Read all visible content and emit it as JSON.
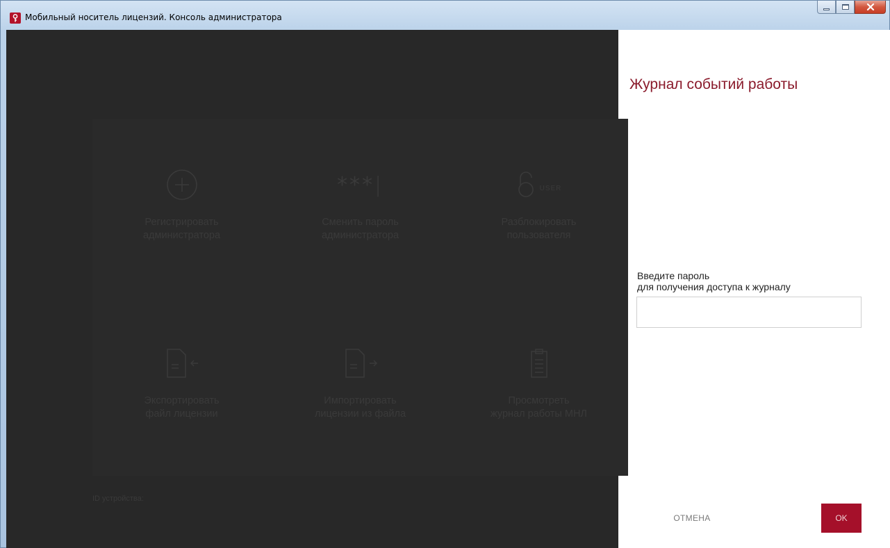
{
  "window": {
    "title": "Мобильный носитель лицензий. Консоль администратора"
  },
  "tiles": [
    {
      "icon": "plus-circle-icon",
      "label": "Регистрировать\nадминистратора"
    },
    {
      "icon": "password-stars-icon",
      "icon_text": "***",
      "label": "Сменить пароль\nадминистратора"
    },
    {
      "icon": "unlock-user-icon",
      "icon_text": "USER",
      "label": "Разблокировать\nпользователя"
    },
    {
      "icon": "export-file-icon",
      "label": "Экспортировать\nфайл лицензии"
    },
    {
      "icon": "import-file-icon",
      "label": "Импортировать\nлицензии из файла"
    },
    {
      "icon": "clipboard-log-icon",
      "label": "Просмотреть\nжурнал работы МНЛ"
    }
  ],
  "footer": {
    "device_id_label": "ID устройства:"
  },
  "panel": {
    "title": "Журнал событий работы",
    "password_label": "Введите пароль\nдля получения доступа к журналу",
    "password_value": "",
    "cancel_label": "ОТМЕНА",
    "ok_label": "OK"
  },
  "colors": {
    "accent": "#a5102a",
    "title": "#8a1a2b",
    "overlay": "#282828"
  }
}
